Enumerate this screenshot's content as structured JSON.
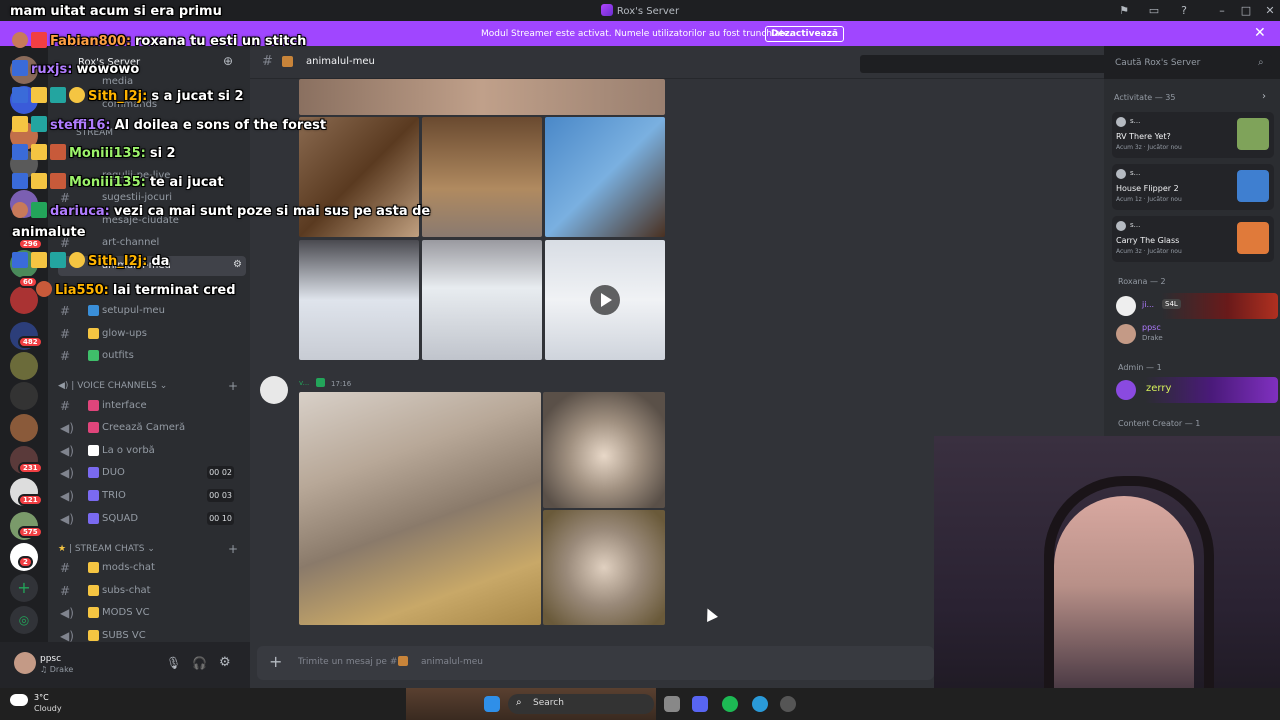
{
  "window": {
    "title": "Rox's Server"
  },
  "banner": {
    "text": "Modul Streamer este activat. Numele utilizatorilor au fost trunchiate.",
    "button": "Dezactivează"
  },
  "server": {
    "name": "Rox's Server"
  },
  "server_badges": [
    "60",
    "296",
    "482",
    "231",
    "121",
    "575",
    "2"
  ],
  "channels_top": [
    {
      "label": "media"
    },
    {
      "label": "commands"
    },
    {
      "label": "STREAM"
    },
    {
      "label": "regulii-pe-live"
    },
    {
      "label": "sugestii-jocuri"
    },
    {
      "label": "mesaje-ciudate"
    },
    {
      "label": "art-channel"
    },
    {
      "label": "animalul-meu"
    },
    {
      "label": "setupul-meu"
    },
    {
      "label": "glow-ups"
    },
    {
      "label": "outfits"
    }
  ],
  "voice_category": "VOICE CHANNELS",
  "voice_channels": [
    {
      "label": "interface"
    },
    {
      "label": "Creează Cameră"
    },
    {
      "label": "La o vorbă"
    },
    {
      "label": "DUO",
      "count": "00 02"
    },
    {
      "label": "TRIO",
      "count": "00 03"
    },
    {
      "label": "SQUAD",
      "count": "00 10"
    }
  ],
  "stream_category": "STREAM CHATS",
  "stream_channels": [
    {
      "label": "mods-chat"
    },
    {
      "label": "subs-chat"
    },
    {
      "label": "MODS VC"
    },
    {
      "label": "SUBS VC"
    }
  ],
  "user": {
    "name": "ppsc",
    "status": "Drake"
  },
  "chat": {
    "channel": "animalul-meu",
    "message_author": "v...",
    "message_time": "17:16",
    "composer_placeholder": "Trimite un mesaj pe #",
    "composer_channel": "animalul-meu"
  },
  "search": {
    "placeholder": "Caută Rox's Server"
  },
  "activity": {
    "header": "Activitate — 35",
    "cards": [
      {
        "user": "s...",
        "title": "RV There Yet?",
        "meta": "Acum 3z  ·  Jucător nou",
        "color": "#7fa35a"
      },
      {
        "user": "s...",
        "title": "House Flipper 2",
        "meta": "Acum 1z  ·  Jucător nou",
        "color": "#3f7fd0"
      },
      {
        "user": "s...",
        "title": "Carry The Glass",
        "meta": "Acum 3z  ·  Jucător nou",
        "color": "#e07a3a"
      }
    ]
  },
  "members": {
    "roxana_group": "Roxana — 2",
    "roxana_users": [
      {
        "name": "ji...",
        "tag": "S4L"
      },
      {
        "name": "ppsc",
        "status": "Drake"
      }
    ],
    "admin_group": "Admin — 1",
    "admin_user": "zerry",
    "creator_group": "Content Creator — 1"
  },
  "taskbar": {
    "weather_temp": "3°C",
    "weather_text": "Cloudy",
    "search": "Search"
  },
  "twitch_chat": [
    {
      "user": "",
      "text": "mam uitat acum si era primu",
      "color": "#ffffff"
    },
    {
      "user": "Fabian800:",
      "text": "roxana tu esti un stitch",
      "color": "#ff9f43"
    },
    {
      "user": "ruxjs:",
      "text": "wowowo",
      "color": "#b07cff"
    },
    {
      "user": "Sith_I2j:",
      "text": "s a jucat si 2",
      "color": "#ffb400"
    },
    {
      "user": "steffi16:",
      "text": "Al doilea e sons of the forest",
      "color": "#b07cff"
    },
    {
      "user": "Moniii135:",
      "text": "si 2",
      "color": "#9cf26b"
    },
    {
      "user": "Moniii135:",
      "text": "te ai jucat",
      "color": "#9cf26b"
    },
    {
      "user": "dariuca:",
      "text": "vezi ca mai sunt poze si mai sus pe asta de",
      "color": "#b07cff"
    },
    {
      "user": "",
      "text": "animalute",
      "color": "#ffffff"
    },
    {
      "user": "Sith_I2j:",
      "text": "da",
      "color": "#ffb400"
    },
    {
      "user": "Lia550:",
      "text": "lai terminat cred",
      "color": "#ffb400"
    }
  ]
}
